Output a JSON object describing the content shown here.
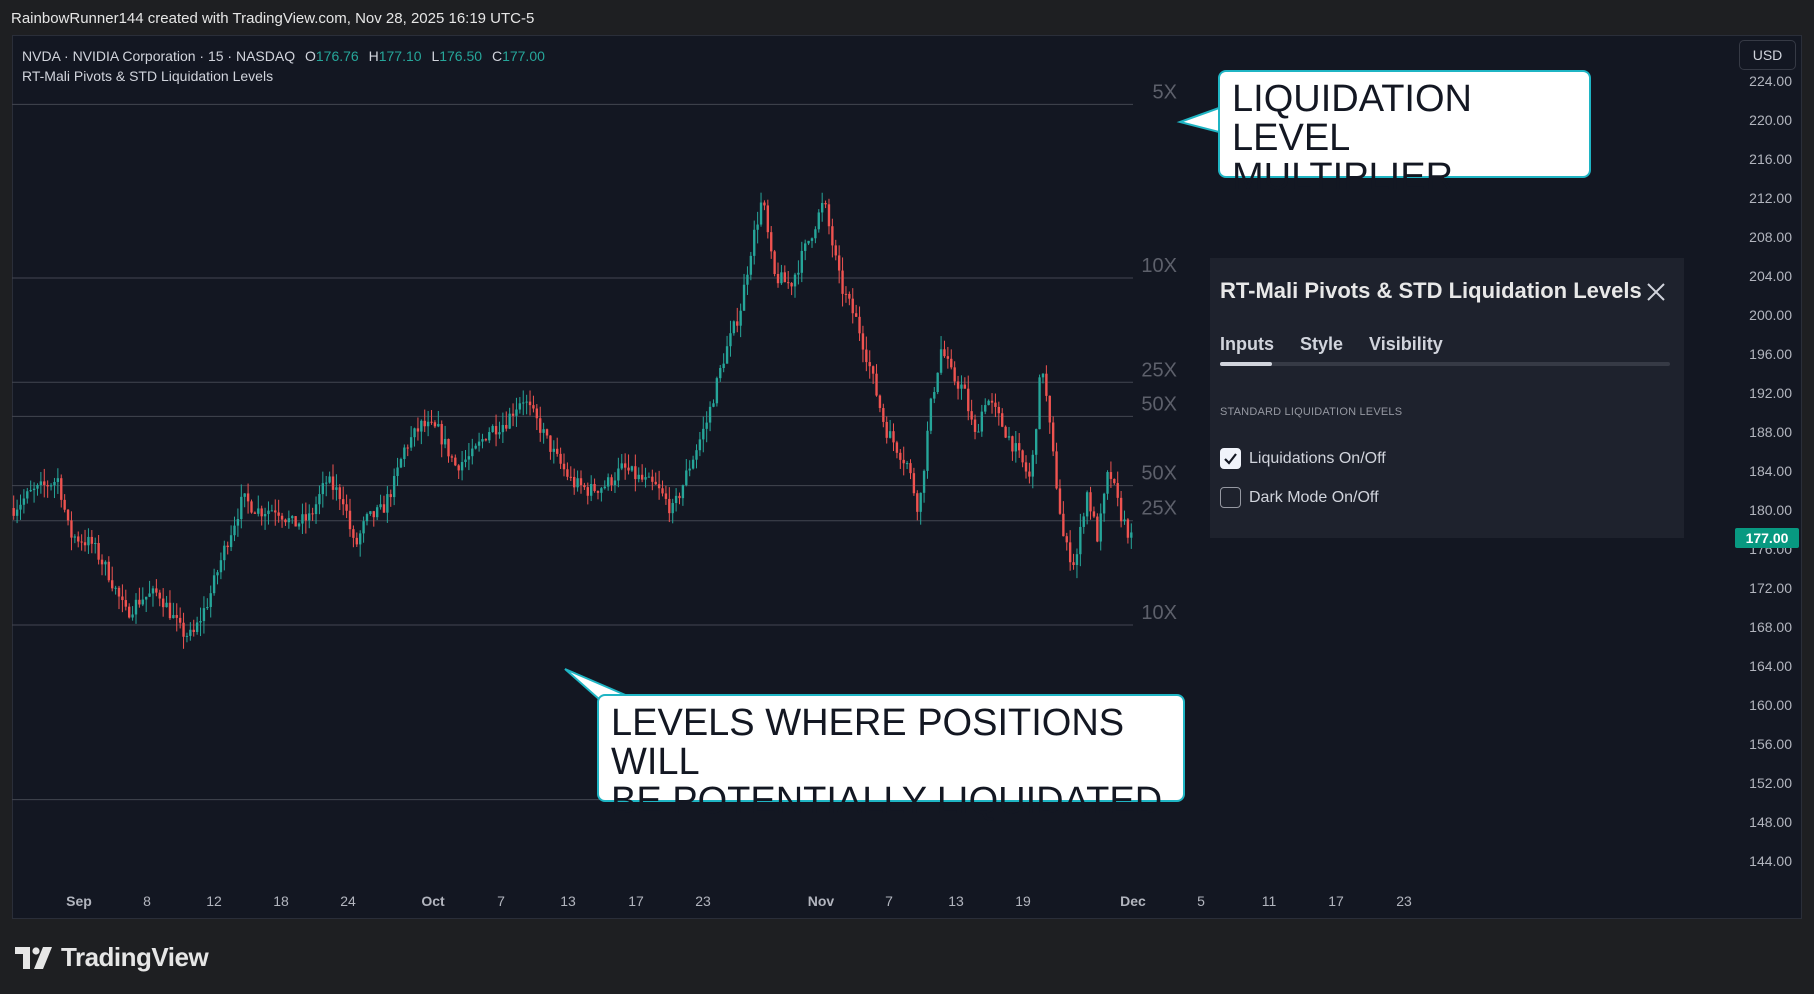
{
  "header": {
    "credit": "RainbowRunner144 created with TradingView.com, Nov 28, 2025 16:19 UTC-5"
  },
  "legend": {
    "symbol": "NVDA · NVIDIA Corporation · 15 · NASDAQ",
    "open_label": "O",
    "open": "176.76",
    "high_label": "H",
    "high": "177.10",
    "low_label": "L",
    "low": "176.50",
    "close_label": "C",
    "close": "177.00",
    "indicator": "RT-Mali Pivots & STD Liquidation Levels"
  },
  "currency_button": "USD",
  "last_price": "177.00",
  "price_axis": {
    "ticks": [
      "224.00",
      "220.00",
      "216.00",
      "212.00",
      "208.00",
      "204.00",
      "200.00",
      "196.00",
      "192.00",
      "188.00",
      "184.00",
      "180.00",
      "176.00",
      "172.00",
      "168.00",
      "164.00",
      "160.00",
      "156.00",
      "152.00",
      "148.00",
      "144.00"
    ]
  },
  "time_axis": {
    "labels": [
      {
        "text": "Sep",
        "bold": true
      },
      {
        "text": "8"
      },
      {
        "text": "12"
      },
      {
        "text": "18"
      },
      {
        "text": "24"
      },
      {
        "text": "Oct",
        "bold": true
      },
      {
        "text": "7"
      },
      {
        "text": "13"
      },
      {
        "text": "17"
      },
      {
        "text": "23"
      },
      {
        "text": "Nov",
        "bold": true
      },
      {
        "text": "7"
      },
      {
        "text": "13"
      },
      {
        "text": "19"
      },
      {
        "text": "Dec",
        "bold": true
      },
      {
        "text": "5"
      },
      {
        "text": "11"
      },
      {
        "text": "17"
      },
      {
        "text": "23"
      }
    ]
  },
  "levels": [
    {
      "label": "5X",
      "price": 221.6
    },
    {
      "label": "10X",
      "price": 203.8
    },
    {
      "label": "25X",
      "price": 193.1
    },
    {
      "label": "50X",
      "price": 189.6
    },
    {
      "label": "50X",
      "price": 182.5
    },
    {
      "label": "25X",
      "price": 178.9
    },
    {
      "label": "10X",
      "price": 168.2
    },
    {
      "label": "5X",
      "price": 150.3
    }
  ],
  "callouts": {
    "top": "LIQUIDATION LEVEL\nMULTIPLIER",
    "bottom": "LEVELS WHERE POSITIONS WILL\nBE POTENTIALLY LIQUIDATED"
  },
  "settings_panel": {
    "title": "RT-Mali Pivots & STD Liquidation Levels",
    "tabs": [
      "Inputs",
      "Style",
      "Visibility"
    ],
    "active_tab": 0,
    "section_label": "STANDARD LIQUIDATION LEVELS",
    "options": [
      {
        "label": "Liquidations On/Off",
        "checked": true
      },
      {
        "label": "Dark Mode On/Off",
        "checked": false
      }
    ]
  },
  "brand": {
    "logo_text": "TradingView"
  },
  "colors": {
    "background": "#131722",
    "up": "#26a69a",
    "down": "#ef5350",
    "accent": "#089981",
    "callout_border": "#1fb5c4"
  },
  "chart_data": {
    "type": "candlestick",
    "symbol": "NVDA",
    "interval": "15",
    "ylim": [
      142,
      226
    ],
    "x_range": [
      "Sep",
      "Dec 23"
    ],
    "price_path": {
      "x": [
        0,
        1.5,
        4,
        5,
        7,
        8.5,
        10,
        11.5,
        13,
        15,
        16,
        17.5,
        19,
        20.5,
        22,
        23.5,
        25,
        26.5,
        28,
        29.5,
        30.5,
        31.5,
        33,
        34,
        35,
        36.5,
        38,
        39.5,
        41,
        42.5,
        44,
        45.5,
        47,
        48.5,
        50,
        51.5,
        53,
        54.5,
        56,
        57.5,
        59,
        60.5,
        62,
        63.5,
        65,
        66,
        67,
        68,
        69.5,
        71,
        72.5,
        74,
        75.5,
        76.5,
        78,
        80,
        81,
        82,
        83,
        84,
        85,
        86,
        87,
        88,
        89.5,
        91,
        92,
        93,
        94,
        95,
        96,
        97,
        98,
        99,
        100
      ],
      "close": [
        180.2,
        181.7,
        183.2,
        177.5,
        176.5,
        173.5,
        169.4,
        171.0,
        171.5,
        167.5,
        167.0,
        171.0,
        176.5,
        181.1,
        179.9,
        180.2,
        178.5,
        179.2,
        183.0,
        181.2,
        176.0,
        178.9,
        180.0,
        182.6,
        186.4,
        188.7,
        188.1,
        184.6,
        185.5,
        188.2,
        189.0,
        191.6,
        188.7,
        185.4,
        182.8,
        182.0,
        182.6,
        184.3,
        183.2,
        182.3,
        179.9,
        184.6,
        189.0,
        195.5,
        200.5,
        207.0,
        212.0,
        204.0,
        203.1,
        207.3,
        211.6,
        203.0,
        199.2,
        195.1,
        188.4,
        184.6,
        179.9,
        190.3,
        196.6,
        193.6,
        192.4,
        187.5,
        191.6,
        189.7,
        186.5,
        183.0,
        195.4,
        185.5,
        176.5,
        174.4,
        182.0,
        177.1,
        184.2,
        179.7,
        177.0
      ]
    }
  }
}
